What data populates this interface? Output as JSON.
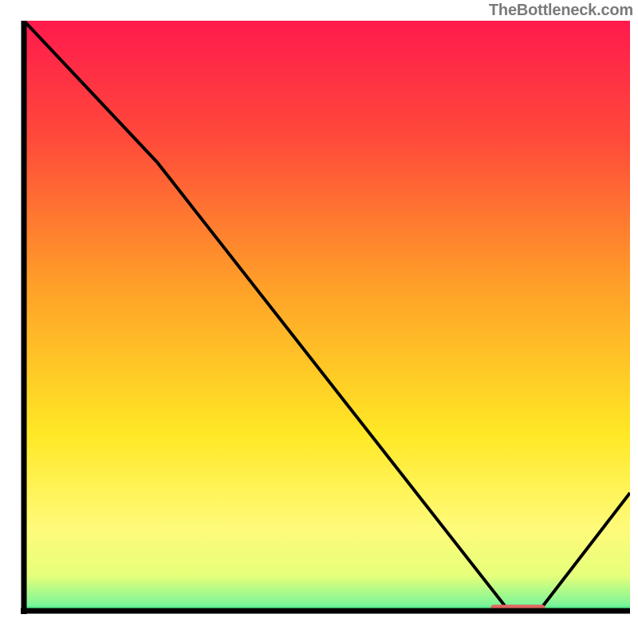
{
  "attribution": "TheBottleneck.com",
  "chart_data": {
    "type": "line",
    "title": "",
    "xlabel": "",
    "ylabel": "",
    "xlim": [
      0,
      100
    ],
    "ylim": [
      0,
      100
    ],
    "series": [
      {
        "name": "bottleneck-curve",
        "x": [
          0,
          22,
          80,
          85,
          100
        ],
        "y": [
          100,
          76,
          0,
          0,
          20
        ]
      }
    ],
    "marker": {
      "name": "optimal-range",
      "x_start": 77,
      "x_end": 86,
      "y": 0.5,
      "color": "#e06662"
    },
    "gradient_stops": [
      {
        "offset": 0.0,
        "color": "#ff1a4d"
      },
      {
        "offset": 0.2,
        "color": "#ff4a3a"
      },
      {
        "offset": 0.45,
        "color": "#ffa028"
      },
      {
        "offset": 0.7,
        "color": "#ffe825"
      },
      {
        "offset": 0.86,
        "color": "#fffb7a"
      },
      {
        "offset": 0.94,
        "color": "#e6ff7a"
      },
      {
        "offset": 0.99,
        "color": "#7cf598"
      },
      {
        "offset": 1.0,
        "color": "#1fe07a"
      }
    ],
    "axis_color": "#000000",
    "curve_color": "#000000"
  }
}
